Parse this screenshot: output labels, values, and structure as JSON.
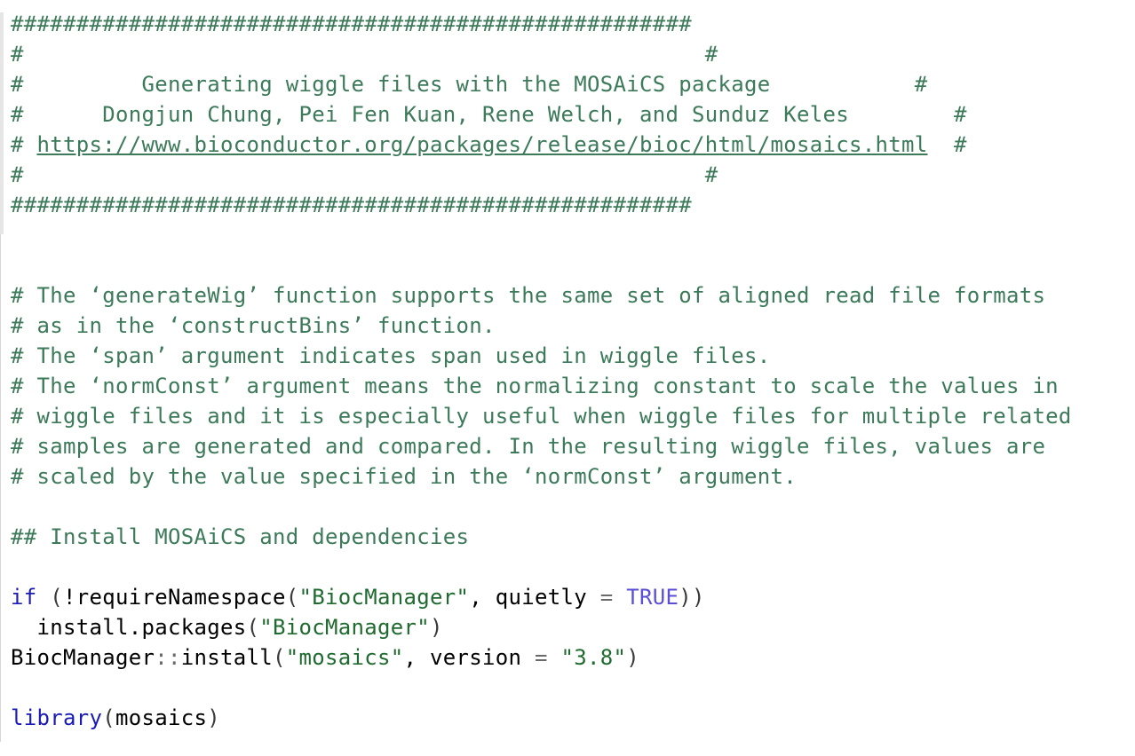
{
  "editor": {
    "header": {
      "border": "####################################################",
      "blank_left": "#",
      "blank_right": "#",
      "title": "Generating wiggle files with the MOSAiCS package",
      "authors": "Dongjun Chung, Pei Fen Kuan, Rene Welch, and Sunduz Keles",
      "url": "https://www.bioconductor.org/packages/release/bioc/html/mosaics.html"
    },
    "comments": [
      "# The ‘generateWig’ function supports the same set of aligned read file formats",
      "# as in the ‘constructBins’ function.",
      "# The ‘span’ argument indicates span used in wiggle files.",
      "# The ‘normConst’ argument means the normalizing constant to scale the values in",
      "# wiggle files and it is especially useful when wiggle files for multiple related",
      "# samples are generated and compared. In the resulting wiggle files, values are",
      "# scaled by the value specified in the ‘normConst’ argument."
    ],
    "section_heading": "## Install MOSAiCS and dependencies",
    "code": {
      "kw_if": "if",
      "require_call": "requireNamespace",
      "biocmanager_str": "\"BiocManager\"",
      "quietly_arg": "quietly",
      "true_val": "TRUE",
      "install_call": "install.packages",
      "biocmanager_ns": "BiocManager",
      "install_fn": "install",
      "mosaics_str": "\"mosaics\"",
      "version_arg": "version",
      "version_str": "\"3.8\"",
      "library_fn": "library",
      "library_arg": "mosaics"
    }
  },
  "colors": {
    "comment": "#3c7a5a",
    "keyword": "#1a1ab8",
    "string": "#1f6b2f",
    "boolean": "#5a4fd6",
    "operator": "#6a6a6a"
  }
}
